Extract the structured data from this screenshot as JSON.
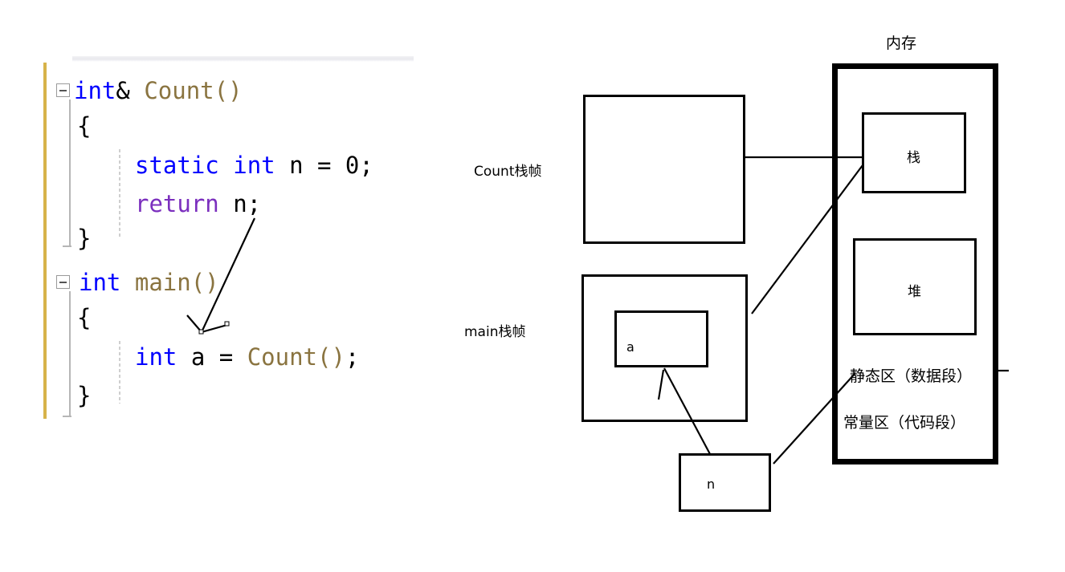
{
  "editor": {
    "lines": [
      {
        "id": "l1",
        "tokens": [
          {
            "t": "int",
            "c": "kw"
          },
          {
            "t": "&",
            "c": "pl"
          },
          {
            "t": " Count()",
            "c": "fn"
          }
        ],
        "plain": "int& Count()"
      },
      {
        "id": "l2",
        "tokens": [
          {
            "t": "{",
            "c": "pl"
          }
        ],
        "plain": "{"
      },
      {
        "id": "l3",
        "tokens": [
          {
            "t": "static",
            "c": "kw"
          },
          {
            "t": " ",
            "c": "pl"
          },
          {
            "t": "int",
            "c": "kw"
          },
          {
            "t": " n = 0;",
            "c": "pl"
          }
        ],
        "plain": "static int n = 0;"
      },
      {
        "id": "l4",
        "tokens": [
          {
            "t": "return",
            "c": "kw2"
          },
          {
            "t": " n;",
            "c": "pl"
          }
        ],
        "plain": "return n;"
      },
      {
        "id": "l5",
        "tokens": [
          {
            "t": "}",
            "c": "pl"
          }
        ],
        "plain": "}"
      },
      {
        "id": "l6",
        "tokens": [
          {
            "t": "int",
            "c": "kw"
          },
          {
            "t": " ",
            "c": "pl"
          },
          {
            "t": "main()",
            "c": "fn"
          }
        ],
        "plain": "int main()"
      },
      {
        "id": "l7",
        "tokens": [
          {
            "t": "{",
            "c": "pl"
          }
        ],
        "plain": "{"
      },
      {
        "id": "l8",
        "tokens": [
          {
            "t": "int",
            "c": "kw"
          },
          {
            "t": " a = ",
            "c": "pl"
          },
          {
            "t": "Count()",
            "c": "fn"
          },
          {
            "t": ";",
            "c": "pl"
          }
        ],
        "plain": "int a = Count();"
      },
      {
        "id": "l9",
        "tokens": [
          {
            "t": "}",
            "c": "pl"
          }
        ],
        "plain": "}"
      }
    ],
    "colors": {
      "keyword": "#0000ff",
      "keyword_flow": "#7b2fbe",
      "function": "#8a7440",
      "plain": "#000000",
      "change_bar": "#d7b34a",
      "fold_guide": "#b6b6b6"
    }
  },
  "diagram": {
    "count_frame_label": "Count栈帧",
    "main_frame_label": "main栈帧",
    "var_a": "a",
    "var_n": "n",
    "memory_title": "内存",
    "stack_label": "栈",
    "heap_label": "堆",
    "static_area_label": "静态区（数据段）",
    "const_area_label": "常量区（代码段）",
    "colors": {
      "stroke": "#000000",
      "fill": "#ffffff"
    }
  }
}
